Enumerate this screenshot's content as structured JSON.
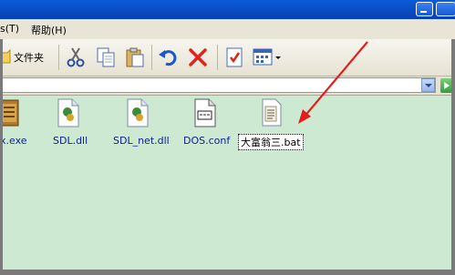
{
  "menubar": {
    "items": [
      {
        "label": "s(T)"
      },
      {
        "label": "帮助(H)"
      }
    ]
  },
  "toolbar": {
    "folders_label": "文件夹",
    "icons": [
      "folder-icon",
      "cut-icon",
      "copy-icon",
      "paste-icon",
      "undo-icon",
      "delete-icon",
      "properties-icon",
      "views-icon"
    ]
  },
  "files": [
    {
      "name": "x.exe",
      "icon": "dosbox-exe-icon"
    },
    {
      "name": "SDL.dll",
      "icon": "dll-file-icon"
    },
    {
      "name": "SDL_net.dll",
      "icon": "dll-file-icon"
    },
    {
      "name": "DOS.conf",
      "icon": "config-file-icon"
    },
    {
      "name": "大富翁三.bat",
      "icon": "batch-file-icon",
      "selected": true
    }
  ],
  "colors": {
    "content_bg": "#cde9d2",
    "arrow": "#e01e1e",
    "title_blue": "#0840b5"
  }
}
